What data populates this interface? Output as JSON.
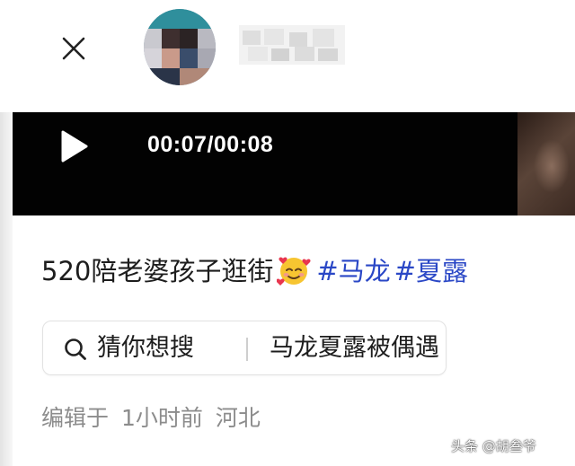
{
  "header": {
    "close_icon": "close-icon",
    "avatar": "pixelated-avatar",
    "username": "博主",
    "username_blurred": true
  },
  "video": {
    "play_icon": "play-icon",
    "time": "00:07/00:08"
  },
  "post": {
    "caption": "520陪老婆孩子逛街",
    "emoji": "smiling-face-with-hearts",
    "hashtags": [
      "#马龙",
      "#夏露"
    ],
    "hashtag_color": "#2a47c6"
  },
  "suggestion": {
    "icon": "search-icon",
    "prefix": "猜你想搜",
    "query": "马龙夏露被偶遇"
  },
  "meta": {
    "edited": "编辑于",
    "time": "1小时前",
    "location": "河北"
  },
  "watermark": {
    "text": "头条 @胡叁爷"
  }
}
